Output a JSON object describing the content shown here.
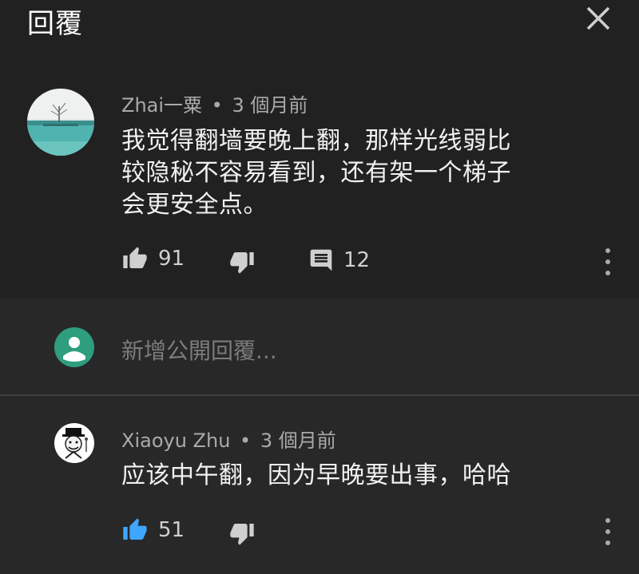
{
  "header": {
    "title": "回覆"
  },
  "top_comment": {
    "author": "Zhai一粟",
    "time": "3 個月前",
    "text_lines": [
      "我觉得翻墙要晚上翻，那样光线弱比",
      "较隐秘不容易看到，还有架一个梯子",
      "会更安全点。"
    ],
    "likes": "91",
    "replies": "12"
  },
  "reply_input": {
    "placeholder": "新增公開回覆..."
  },
  "replies": [
    {
      "author": "Xiaoyu Zhu",
      "time": "3 個月前",
      "text": "应该中午翻，因为早晚要出事，哈哈",
      "likes": "51",
      "liked": true
    }
  ],
  "colors": {
    "background": "#282828",
    "header_bg": "#212121",
    "like_active": "#3ea6ff",
    "meta_text": "#aaaaaa",
    "avatar_green": "#2e9e7e"
  },
  "separator": "•"
}
